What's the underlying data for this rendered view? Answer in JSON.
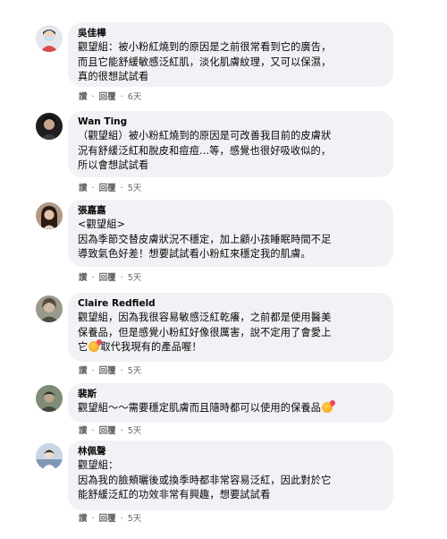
{
  "comments": [
    {
      "author": "吳佳樺",
      "text": "觀望組：被小粉紅燒到的原因是之前很常看到它的廣告，\n而且它能舒緩敏感泛紅肌，淡化肌膚紋理，又可以保濕，\n真的很想試試看",
      "emoji": false,
      "like": "讚",
      "reply": "回覆",
      "sep": "·",
      "time": "6天",
      "avatar_color": "#cfd6de"
    },
    {
      "author": "Wan Ting",
      "text": "（觀望組）被小粉紅燒到的原因是可改善我目前的皮膚狀\n況有舒緩泛紅和脫皮和痘痘...等，感覺也很好吸收似的，\n所以會想試試看",
      "emoji": false,
      "like": "讚",
      "reply": "回覆",
      "sep": "·",
      "time": "5天",
      "avatar_color": "#2b2b2b"
    },
    {
      "author": "張嘉嘉",
      "text": "<觀望組>\n因為季節交替皮膚狀況不穩定，加上顧小孩睡眠時間不足\n導致氣色好差！想要試試看小粉紅來穩定我的肌膚。",
      "emoji": false,
      "like": "讚",
      "reply": "回覆",
      "sep": "·",
      "time": "5天",
      "avatar_color": "#6b4a3a"
    },
    {
      "author": "Claire Redfield",
      "text_before": "觀望組，因為我很容易敏感泛紅乾癢，之前都是使用醫美\n保養品，但是感覺小粉紅好像很厲害，說不定用了會愛上\n它",
      "text_after": "取代我現有的產品喔！",
      "emoji": true,
      "like": "讚",
      "reply": "回覆",
      "sep": "·",
      "time": "5天",
      "avatar_color": "#8a8a7a"
    },
    {
      "author": "裴斯",
      "text_before": "觀望組～～需要穩定肌膚而且隨時都可以使用的保養品",
      "text_after": "",
      "emoji": true,
      "like": "讚",
      "reply": "回覆",
      "sep": "·",
      "time": "5天",
      "avatar_color": "#5f6d5a"
    },
    {
      "author": "林佩聲",
      "text": "觀望組：\n因為我的臉頰曬後或換季時都非常容易泛紅，因此對於它\n能舒緩泛紅的功效非常有興趣，想要試試看",
      "emoji": false,
      "like": "讚",
      "reply": "回覆",
      "sep": "·",
      "time": "5天",
      "avatar_color": "#9db0c9"
    }
  ]
}
